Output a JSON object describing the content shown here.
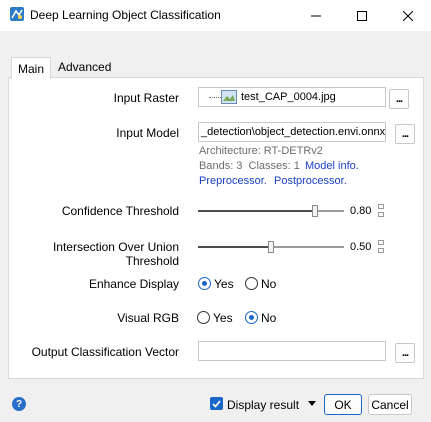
{
  "window": {
    "title": "Deep Learning Object Classification",
    "icon": "app-icon",
    "controls": [
      "minimize-icon",
      "maximize-icon",
      "close-icon"
    ]
  },
  "tabs": [
    {
      "label": "Main",
      "active": true
    },
    {
      "label": "Advanced",
      "active": false
    }
  ],
  "form": {
    "input_raster": {
      "label": "Input Raster",
      "value": "test_CAP_0004.jpg",
      "browse": "..."
    },
    "input_model": {
      "label": "Input Model",
      "value": "_detection\\object_detection.envi.onnx",
      "browse": "...",
      "architecture": "Architecture: RT-DETRv2",
      "bands_classes": "Bands: 3  Classes: 1",
      "model_info_link": "Model info.",
      "preprocessor_link": "Preprocessor.",
      "postprocessor_link": "Postprocessor."
    },
    "confidence_threshold": {
      "label": "Confidence Threshold",
      "value": "0.80",
      "level": 0.8
    },
    "iou_threshold": {
      "label": "Intersection Over Union Threshold",
      "value": "0.50",
      "level": 0.5
    },
    "enhance_display": {
      "label": "Enhance Display",
      "yes": "Yes",
      "no": "No",
      "selected": "Yes"
    },
    "visual_rgb": {
      "label": "Visual RGB",
      "yes": "Yes",
      "no": "No",
      "selected": "No"
    },
    "output_vector": {
      "label": "Output Classification Vector",
      "value": "",
      "browse": "..."
    }
  },
  "footer": {
    "help_icon": "?",
    "display_result": {
      "label": "Display result",
      "checked": true
    },
    "ok": "OK",
    "cancel": "Cancel"
  },
  "colors": {
    "accent": "#1a66c9",
    "link": "#1a3fc4",
    "meta_text": "#6d6d6d"
  }
}
